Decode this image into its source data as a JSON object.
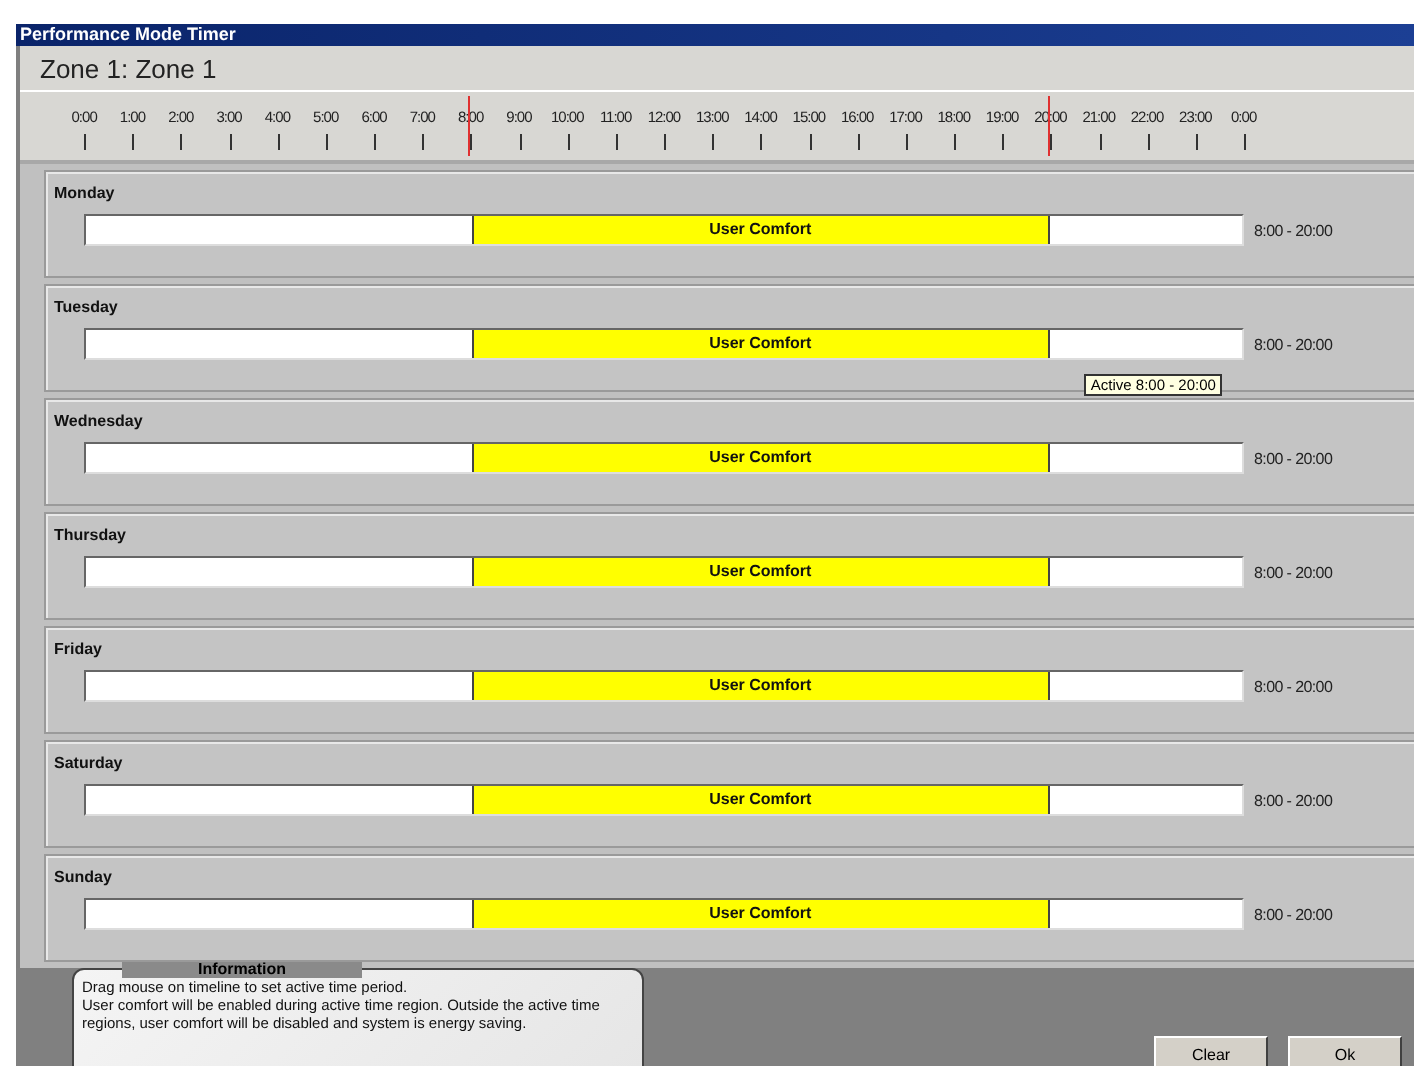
{
  "window": {
    "title": "Performance Mode Timer"
  },
  "zone_title": "Zone 1: Zone 1",
  "timeline": {
    "labels": [
      "0:00",
      "1:00",
      "2:00",
      "3:00",
      "4:00",
      "5:00",
      "6:00",
      "7:00",
      "8:00",
      "9:00",
      "10:00",
      "11:00",
      "12:00",
      "13:00",
      "14:00",
      "15:00",
      "16:00",
      "17:00",
      "18:00",
      "19:00",
      "20:00",
      "21:00",
      "22:00",
      "23:00",
      "0:00"
    ]
  },
  "days": [
    {
      "name": "Monday",
      "label": "User Comfort",
      "range": "8:00 - 20:00"
    },
    {
      "name": "Tuesday",
      "label": "User Comfort",
      "range": "8:00 - 20:00",
      "tooltip": "Active  8:00 - 20:00"
    },
    {
      "name": "Wednesday",
      "label": "User Comfort",
      "range": "8:00 - 20:00"
    },
    {
      "name": "Thursday",
      "label": "User Comfort",
      "range": "8:00 - 20:00"
    },
    {
      "name": "Friday",
      "label": "User Comfort",
      "range": "8:00 - 20:00"
    },
    {
      "name": "Saturday",
      "label": "User Comfort",
      "range": "8:00 - 20:00"
    },
    {
      "name": "Sunday",
      "label": "User Comfort",
      "range": "8:00 - 20:00"
    }
  ],
  "information": {
    "title": "Information",
    "lines": [
      "Drag mouse on timeline to set active time period.",
      "User comfort will be enabled during active time region. Outside the active time regions, user comfort will be disabled and system is energy saving."
    ]
  },
  "buttons": [
    "Clear",
    "Ok"
  ]
}
